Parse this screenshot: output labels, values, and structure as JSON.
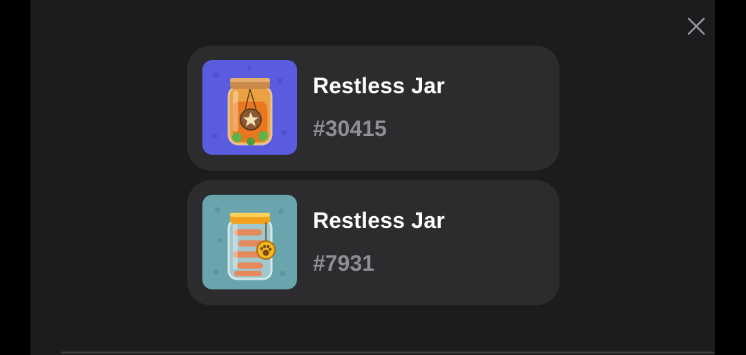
{
  "close": {
    "icon": "close-icon"
  },
  "items": [
    {
      "name": "Restless Jar",
      "id": "#30415",
      "thumbnail": {
        "icon": "jar-star-tag-icon",
        "background": "#5b5be0"
      }
    },
    {
      "name": "Restless Jar",
      "id": "#7931",
      "thumbnail": {
        "icon": "jar-bones-paw-tag-icon",
        "background": "#6aa4ad"
      }
    }
  ],
  "colors": {
    "sheet": "#1c1c1e",
    "card": "#2c2c2e",
    "title": "#ffffff",
    "subtitle": "#8e8e93"
  }
}
